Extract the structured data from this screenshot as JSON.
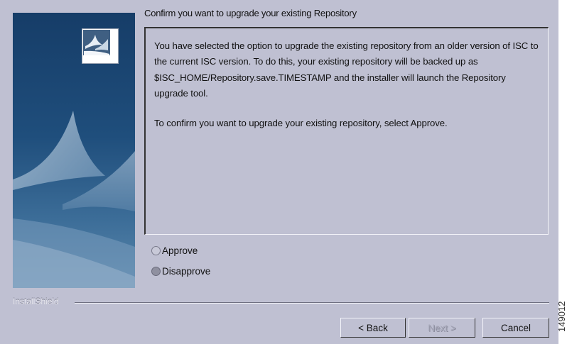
{
  "dialog": {
    "title": "Confirm you want to upgrade your existing Repository",
    "paragraphs": [
      "You have selected the option to upgrade the existing repository from an older version of ISC to the current ISC version. To do this, your existing repository will be backed up as $ISC_HOME/Repository.save.TIMESTAMP and the installer will launch the Repository upgrade tool.",
      "To confirm you want to upgrade your existing repository, select Approve."
    ],
    "options": [
      {
        "label": "Approve",
        "selected": false
      },
      {
        "label": "Disapprove",
        "selected": true
      }
    ],
    "brand": "InstallShield"
  },
  "buttons": {
    "back": "< Back",
    "next": "Next >",
    "cancel": "Cancel"
  },
  "figure_id": "149012",
  "colors": {
    "dialog_bg": "#bfc0d2",
    "side_panel": "#1f4e7c"
  }
}
